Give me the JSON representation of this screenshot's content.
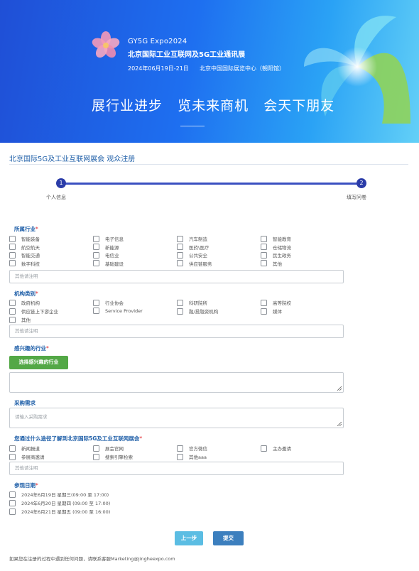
{
  "banner": {
    "line1": "GY5G  Expo2024",
    "line2": "北京国际工业互联网及5G工业通讯展",
    "line3": "2024年06月19日-21日      北京中国国际展览中心（朝阳馆）",
    "slogan": "展行业进步   览未来商机   会天下朋友"
  },
  "page_title": "北京国际5G及工业互联网展会 观众注册",
  "steps": [
    {
      "num": "1",
      "label": "个人信息"
    },
    {
      "num": "2",
      "label": "填写问卷"
    }
  ],
  "industry": {
    "title": "所属行业",
    "required": "*",
    "options": [
      "智能装备",
      "电子信息",
      "汽车制造",
      "智能教育",
      "航空航天",
      "新能源",
      "医药\\医疗",
      "仓储物流",
      "智能交通",
      "电信业",
      "公共安全",
      "民生政务",
      "数字科技",
      "基础建设",
      "供应链服务",
      "其他"
    ],
    "other_placeholder": "其他请注明"
  },
  "org_type": {
    "title": "机构类别",
    "required": "*",
    "options": [
      "政府机构",
      "行业协会",
      "科研院所",
      "高等院校",
      "供应链上下游企业",
      "Service Provider",
      "融/投融资机构",
      "媒体",
      "其他"
    ],
    "other_placeholder": "其他请注明"
  },
  "interest": {
    "title": "感兴趣的行业",
    "required": "*",
    "button_label": "选择感兴趣的行业"
  },
  "purchase": {
    "title": "采购需求",
    "placeholder": "请输入采购需求"
  },
  "source": {
    "title": "您通过什么途径了解到北京国际5G及工业互联网展会",
    "required": "*",
    "options": [
      "新闻报道",
      "展会官网",
      "官方微信",
      "主办邀请",
      "参展商邀请",
      "搜索引擎检索",
      "其他aaa"
    ],
    "other_placeholder": "其他请注明"
  },
  "visit_date": {
    "title": "参观日期",
    "required": "*",
    "options": [
      "2024年6月19日 星期三(09:00 至 17:00)",
      "2024年6月20日 星期四 (09:00 至 17:00)",
      "2024年6月21日 星期五 (09:00 至 16:00)"
    ]
  },
  "buttons": {
    "prev": "上一步",
    "submit": "提交"
  },
  "footer": "如果您在注册的过程中遇到任何问题，请联系客服Marketing@jingheexpo.com"
}
